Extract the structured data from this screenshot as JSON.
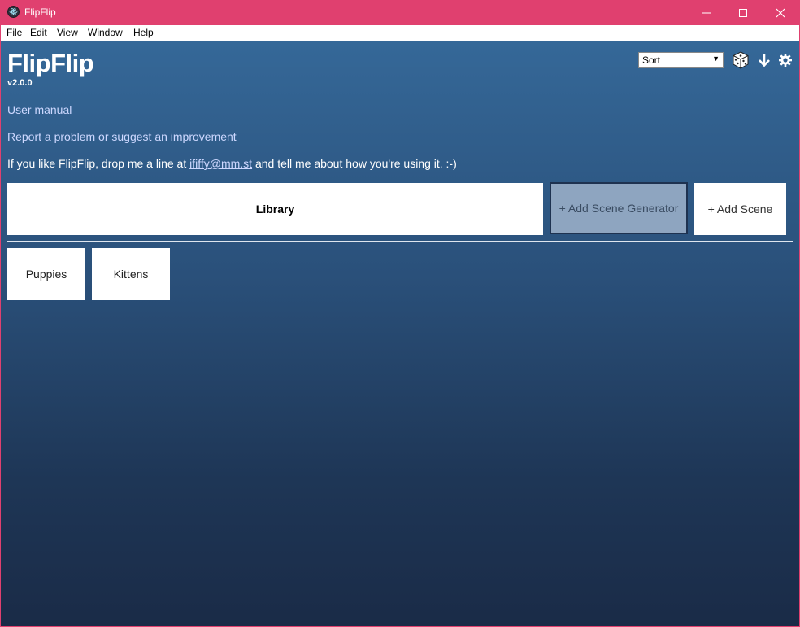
{
  "window": {
    "title": "FlipFlip",
    "app_icon": "electron-icon",
    "controls": [
      "minimize-icon",
      "maximize-icon",
      "close-icon"
    ]
  },
  "menu": [
    "File",
    "Edit",
    "View",
    "Window",
    "Help"
  ],
  "header": {
    "app_name": "FlipFlip",
    "version": "v2.0.0"
  },
  "links": {
    "manual": "User manual",
    "report": "Report a problem or suggest an improvement"
  },
  "contact": {
    "prefix": "If you like FlipFlip, drop me a line at ",
    "email": "ififfy@mm.st",
    "suffix": " and tell me about how you're using it. :-)"
  },
  "toolbar": {
    "sort_value": "Sort",
    "icons": [
      "dice-icon",
      "arrow-down-icon",
      "gear-icon"
    ]
  },
  "actions": {
    "library": "Library",
    "add_generator": "+ Add Scene Generator",
    "add_scene": "+ Add Scene"
  },
  "scenes": [
    "Puppies",
    "Kittens"
  ],
  "colors": {
    "titlebar": "#e0406f",
    "background_top": "#356898",
    "background_bottom": "#1a2b47",
    "link": "#cdd8ff"
  }
}
